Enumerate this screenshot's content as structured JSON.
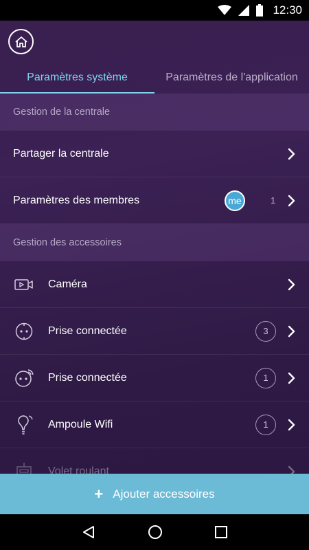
{
  "status_bar": {
    "time": "12:30"
  },
  "header": {
    "home_icon": "home-icon"
  },
  "tabs": [
    {
      "label": "Paramètres système",
      "active": true
    },
    {
      "label": "Paramètres de l'application",
      "active": false
    }
  ],
  "sections": {
    "central": {
      "title": "Gestion de la centrale"
    },
    "accessories": {
      "title": "Gestion des accessoires"
    }
  },
  "central_items": {
    "share": {
      "label": "Partager la centrale"
    },
    "members": {
      "label": "Paramètres des membres",
      "avatar": "me",
      "count": "1"
    }
  },
  "accessories": [
    {
      "label": "Caméra",
      "icon": "camera-icon",
      "count": ""
    },
    {
      "label": "Prise connectée",
      "icon": "plug-icon",
      "count": "3"
    },
    {
      "label": "Prise connectée",
      "icon": "plug-wifi-icon",
      "count": "1"
    },
    {
      "label": "Ampoule Wifi",
      "icon": "bulb-icon",
      "count": "1"
    },
    {
      "label": "Volet roulant",
      "icon": "shutter-icon",
      "count": ""
    }
  ],
  "add_button": {
    "label": "Ajouter accessoires"
  },
  "colors": {
    "accent": "#7fd3ee",
    "add_bar": "#6bbad6",
    "background": "#3a2050"
  }
}
